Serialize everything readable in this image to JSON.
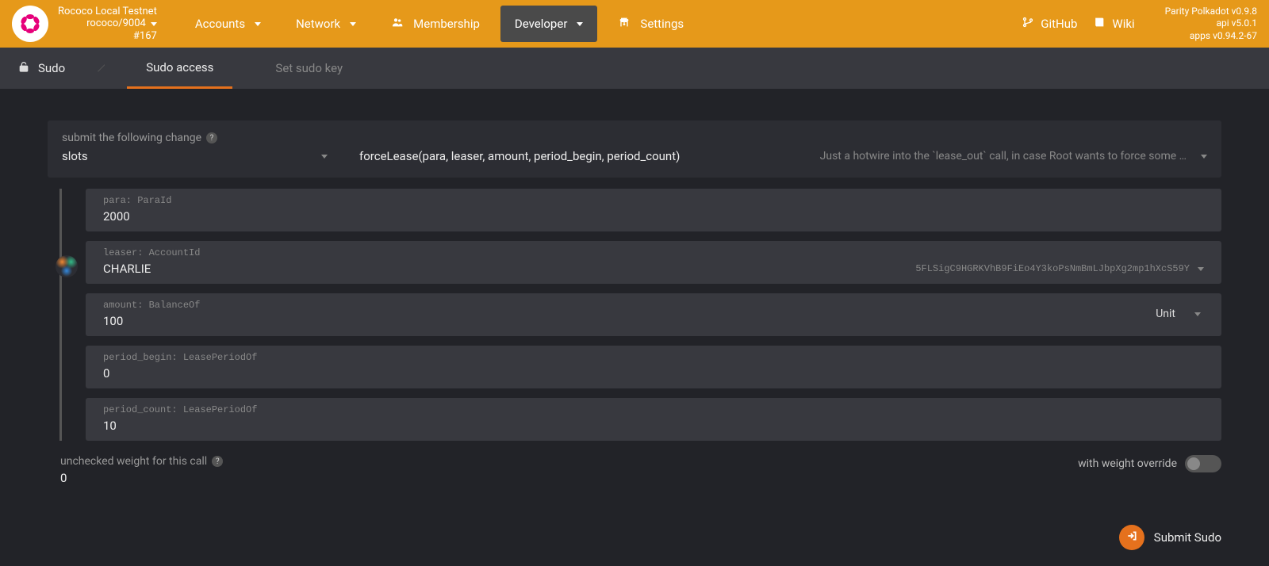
{
  "header": {
    "network_name": "Rococo Local Testnet",
    "network_spec": "rococo/9004",
    "block_number": "#167"
  },
  "nav": {
    "accounts": "Accounts",
    "network": "Network",
    "membership": "Membership",
    "developer": "Developer",
    "settings": "Settings",
    "github": "GitHub",
    "wiki": "Wiki"
  },
  "version": {
    "line1": "Parity Polkadot v0.9.8",
    "line2": "api v5.0.1",
    "line3": "apps v0.94.2-67"
  },
  "subnav": {
    "title": "Sudo",
    "tab_access": "Sudo access",
    "tab_setkey": "Set sudo key"
  },
  "form": {
    "submit_label": "submit the following change",
    "module": "slots",
    "method_sig": "forceLease(para, leaser, amount, period_begin, period_count)",
    "method_desc": "Just a hotwire into the `lease_out` call, in case Root wants to force some …",
    "params": {
      "para_label": "para: ParaId",
      "para_value": "2000",
      "leaser_label": "leaser: AccountId",
      "leaser_name": "CHARLIE",
      "leaser_address": "5FLSigC9HGRKVhB9FiEo4Y3koPsNmBmLJbpXg2mp1hXcS59Y",
      "amount_label": "amount: BalanceOf",
      "amount_value": "100",
      "amount_unit": "Unit",
      "period_begin_label": "period_begin: LeasePeriodOf",
      "period_begin_value": "0",
      "period_count_label": "period_count: LeasePeriodOf",
      "period_count_value": "10"
    },
    "weight_label": "unchecked weight for this call",
    "weight_value": "0",
    "weight_override_label": "with weight override",
    "submit_button": "Submit Sudo"
  }
}
